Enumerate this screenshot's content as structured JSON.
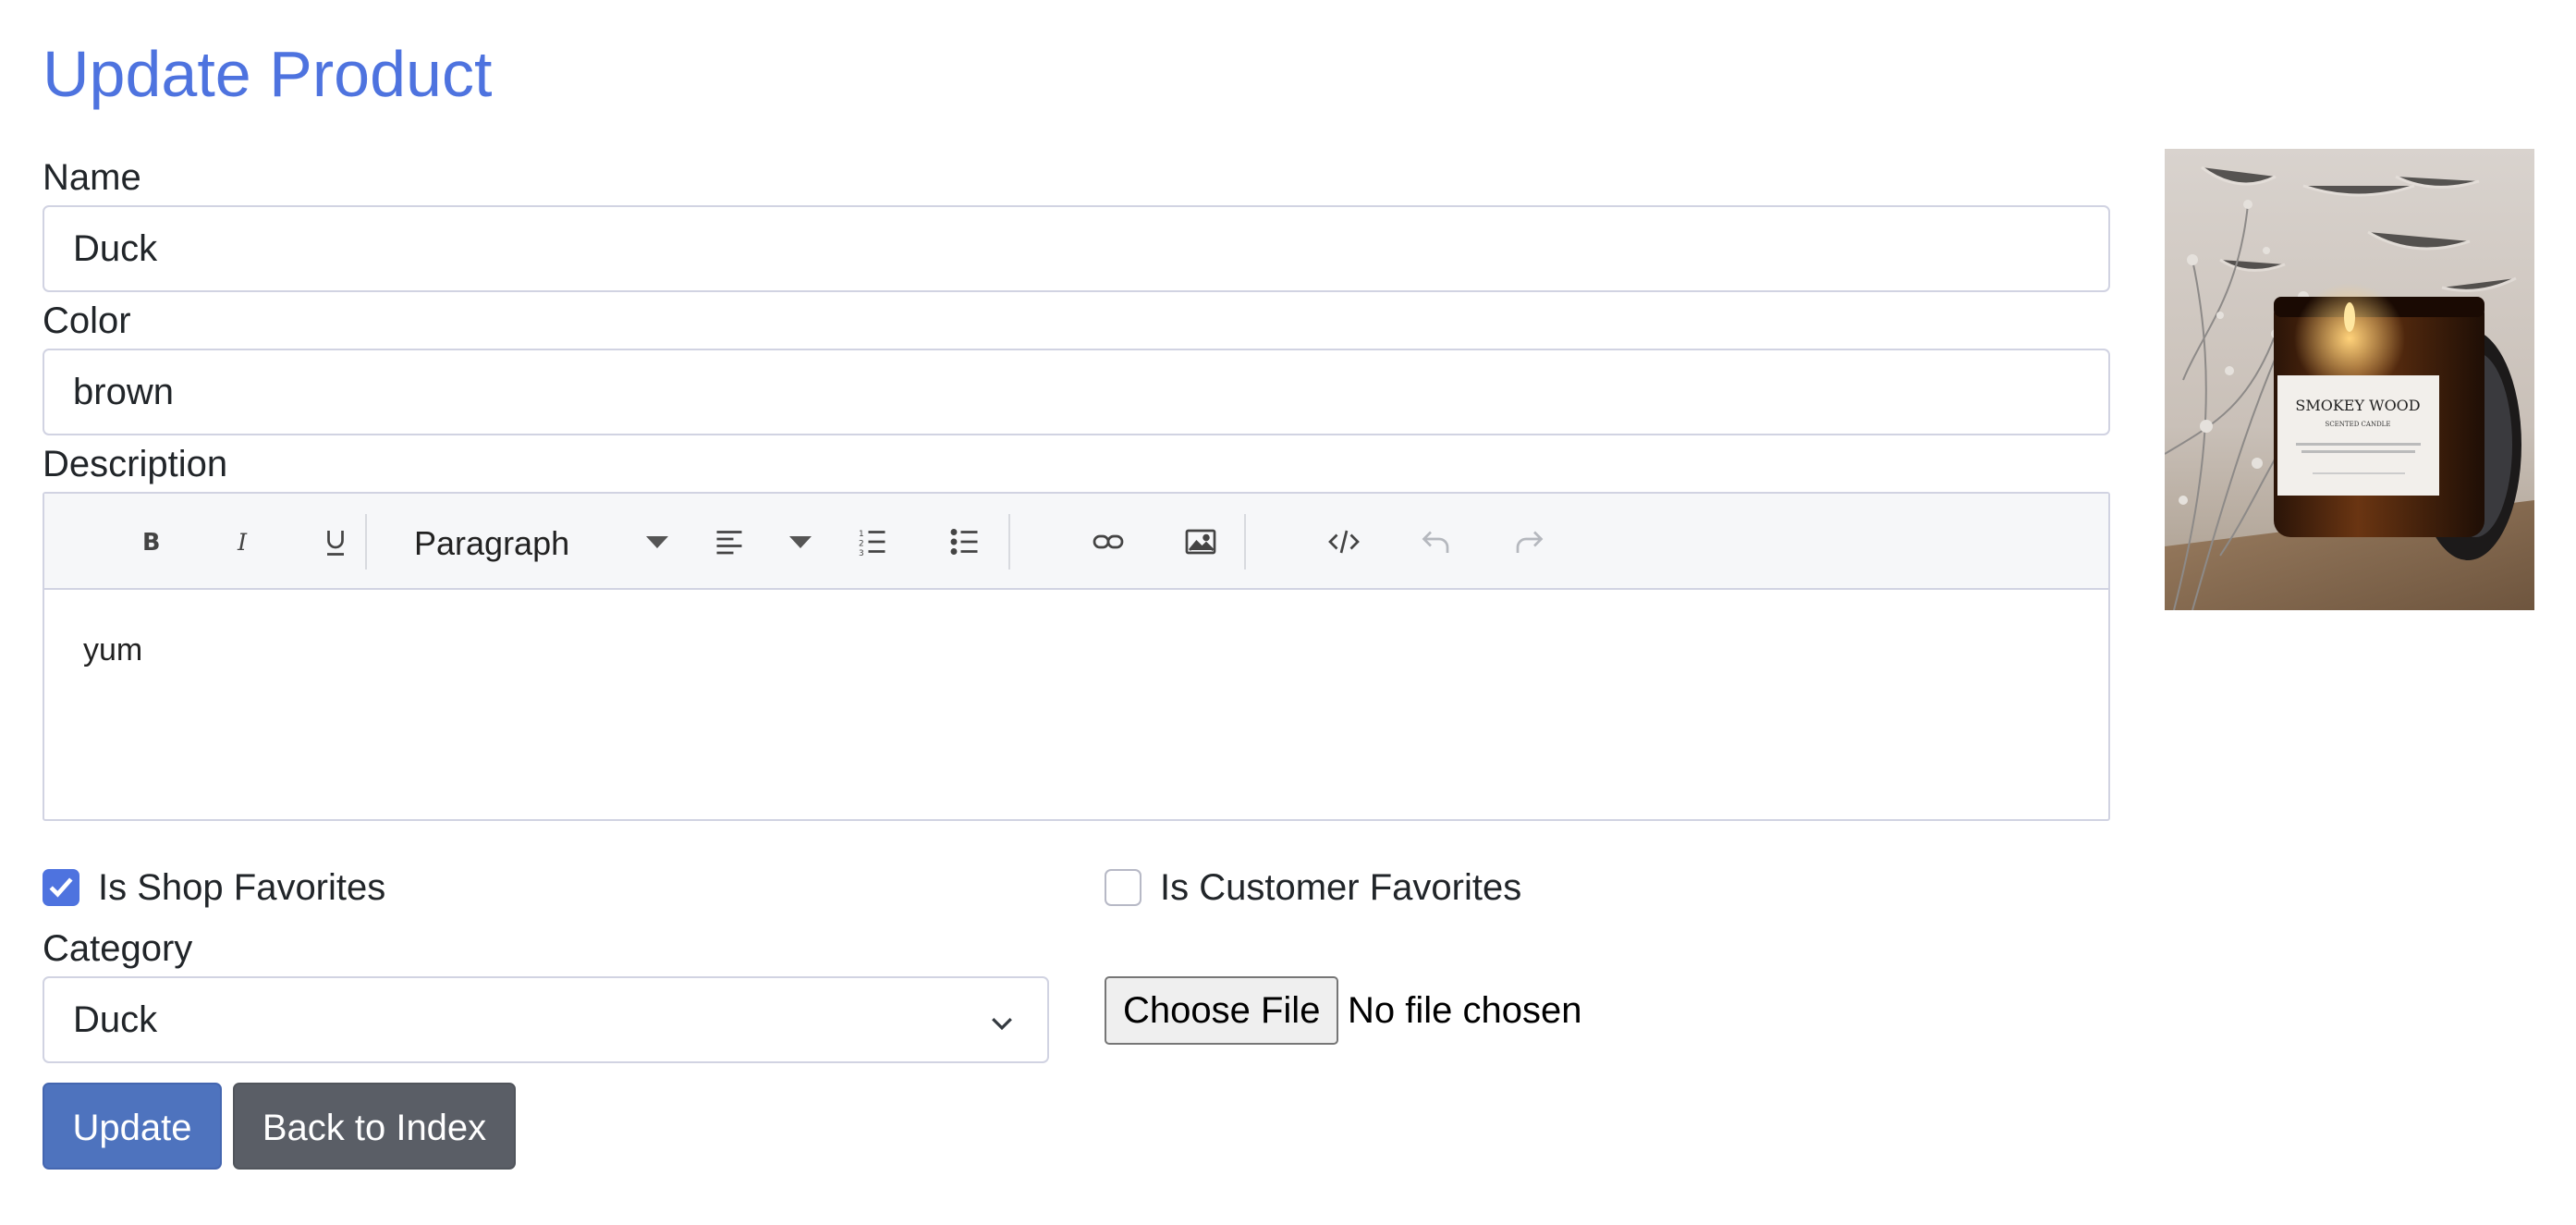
{
  "page": {
    "title": "Update Product"
  },
  "form": {
    "name": {
      "label": "Name",
      "value": "Duck"
    },
    "color": {
      "label": "Color",
      "value": "brown"
    },
    "description": {
      "label": "Description",
      "block_format": "Paragraph",
      "content": "yum",
      "toolbar_icons": [
        "bold-icon",
        "italic-icon",
        "underline-icon",
        "align-left-icon",
        "numbered-list-icon",
        "bullet-list-icon",
        "link-icon",
        "image-icon",
        "code-icon",
        "undo-icon",
        "redo-icon"
      ]
    },
    "shop_favorites": {
      "label": "Is Shop Favorites",
      "checked": true
    },
    "customer_favorites": {
      "label": "Is Customer Favorites",
      "checked": false
    },
    "category": {
      "label": "Category",
      "selected": "Duck"
    },
    "file": {
      "button": "Choose File",
      "status": "No file chosen"
    },
    "buttons": {
      "update": "Update",
      "back": "Back to Index"
    }
  },
  "product_image": {
    "label_line1": "SMOKEY WOOD",
    "label_line2": "SCENTED CANDLE"
  },
  "colors": {
    "accent": "#4e73df",
    "primary_button": "#4e73be",
    "secondary_button": "#5a5e66",
    "border": "#d1d3e2"
  }
}
